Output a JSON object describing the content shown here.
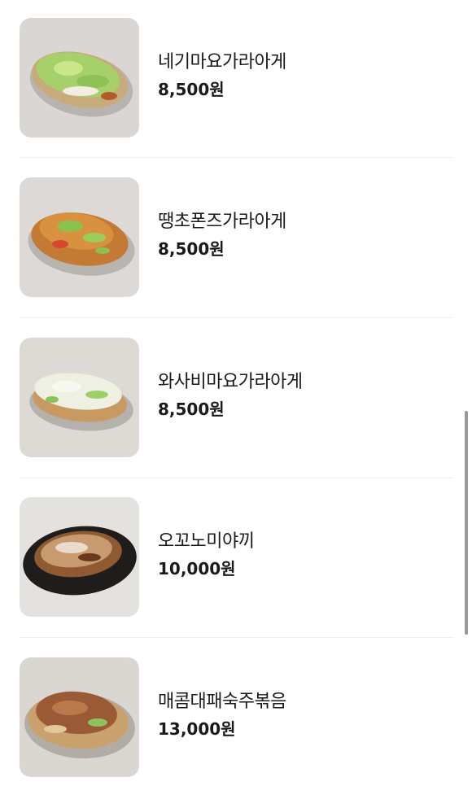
{
  "menu": {
    "items": [
      {
        "name": "네기마요가라아게",
        "price": "8,500원"
      },
      {
        "name": "땡초폰즈가라아게",
        "price": "8,500원"
      },
      {
        "name": "와사비마요가라아게",
        "price": "8,500원"
      },
      {
        "name": "오꼬노미야끼",
        "price": "10,000원"
      },
      {
        "name": "매콤대패숙주볶음",
        "price": "13,000원"
      }
    ]
  }
}
